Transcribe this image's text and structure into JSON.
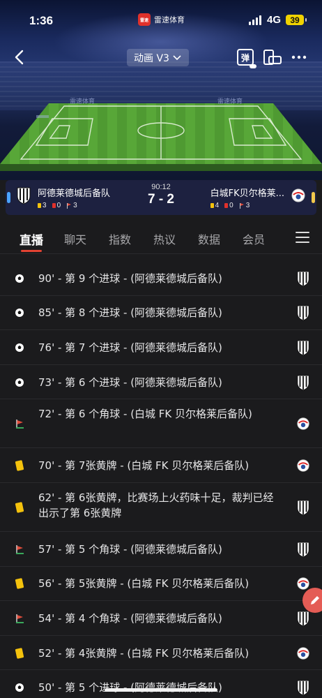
{
  "status_bar": {
    "time": "1:36",
    "app_name": "雷速体育",
    "logo_text": "雷速",
    "network": "4G",
    "battery": "39"
  },
  "nav": {
    "title": "动画 V3",
    "danmu_label": "弹"
  },
  "stadium": {
    "board_text": "雷速体育"
  },
  "match": {
    "minute": "90:12",
    "score": "7 - 2",
    "home": {
      "name": "阿德莱德城后备队",
      "yellow": "3",
      "red": "0",
      "corners": "3",
      "accent": "#4aa3ff"
    },
    "away": {
      "name": "白城FK贝尔格莱...",
      "yellow": "4",
      "red": "0",
      "corners": "3",
      "accent": "#f2c94c"
    }
  },
  "tabs": [
    {
      "label": "直播",
      "active": true
    },
    {
      "label": "聊天"
    },
    {
      "label": "指数"
    },
    {
      "label": "热议"
    },
    {
      "label": "数据"
    },
    {
      "label": "会员"
    }
  ],
  "events": [
    {
      "type": "goal",
      "team": "home",
      "text": "90' - 第 9 个进球 - (阿德莱德城后备队)"
    },
    {
      "type": "goal",
      "team": "home",
      "text": "85' - 第 8 个进球 - (阿德莱德城后备队)"
    },
    {
      "type": "goal",
      "team": "home",
      "text": "76' - 第 7 个进球 - (阿德莱德城后备队)"
    },
    {
      "type": "goal",
      "team": "home",
      "text": "73' - 第 6 个进球 - (阿德莱德城后备队)"
    },
    {
      "type": "corner",
      "team": "away",
      "text": "72' - 第 6 个角球 - (白城 FK 贝尔格莱后备队)"
    },
    {
      "type": "yellow",
      "team": "away",
      "text": "70' - 第 7张黄牌 - (白城 FK 贝尔格莱后备队)"
    },
    {
      "type": "yellow",
      "team": "home",
      "text": "62' - 第 6张黄牌，比赛场上火药味十足，裁判已经出示了第 6张黄牌"
    },
    {
      "type": "corner",
      "team": "home",
      "text": "57' - 第 5 个角球 - (阿德莱德城后备队)"
    },
    {
      "type": "yellow",
      "team": "away",
      "text": "56' - 第 5张黄牌 - (白城 FK 贝尔格莱后备队)"
    },
    {
      "type": "corner",
      "team": "home",
      "text": "54' - 第 4 个角球 - (阿德莱德城后备队)"
    },
    {
      "type": "yellow",
      "team": "away",
      "text": "52' - 第 4张黄牌 - (白城 FK 贝尔格莱后备队)"
    },
    {
      "type": "goal",
      "team": "home",
      "text": "50' - 第 5 个进球 - (阿德莱德城后备队)"
    }
  ]
}
